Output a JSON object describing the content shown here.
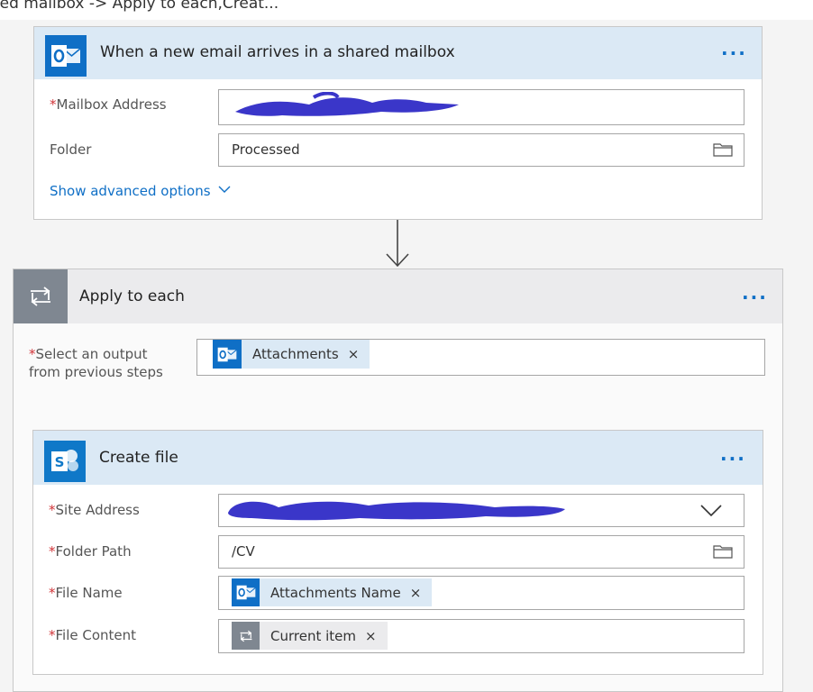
{
  "breadcrumb": "red mailbox -> Apply to each,Creat...",
  "trigger": {
    "title": "When a new email arrives in a shared mailbox",
    "more": "...",
    "mailbox_label": "Mailbox Address",
    "folder_label": "Folder",
    "folder_value": "Processed",
    "advanced_label": "Show advanced options"
  },
  "apply": {
    "title": "Apply to each",
    "more": "...",
    "select_label_1": "Select an output",
    "select_label_2": "from previous steps",
    "token_label": "Attachments",
    "token_remove": "×"
  },
  "create": {
    "title": "Create file",
    "more": "...",
    "site_label": "Site Address",
    "folder_label": "Folder Path",
    "folder_value": "/CV",
    "filename_label": "File Name",
    "filename_token": "Attachments Name",
    "filecontent_label": "File Content",
    "filecontent_token": "Current item",
    "token_remove": "×"
  },
  "required_mark": "*",
  "colors": {
    "accent": "#0f6fc6",
    "header": "#dbe9f5",
    "loop": "#7f8791",
    "scribble": "#3a36c9"
  },
  "icons": [
    "outlook-icon",
    "loop-icon",
    "sharepoint-icon",
    "folder-icon",
    "chevron-down-icon",
    "more-icon",
    "arrow-down-icon"
  ]
}
